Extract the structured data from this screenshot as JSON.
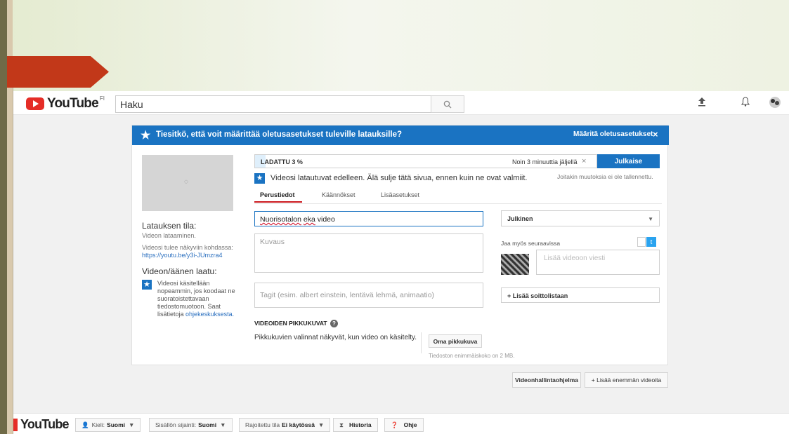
{
  "youtube": {
    "logo_text": "YouTube",
    "logo_region": "FI",
    "search_value": "Haku",
    "icons": {
      "search": "search-icon",
      "upload": "upload-icon",
      "bell": "bell-icon",
      "avatar": "avatar-icon"
    }
  },
  "banner": {
    "text": "Tiesitkö, että voit määrittää oletusasetukset tuleville latauksille?",
    "button": "Määritä oletusasetukset",
    "close": "×"
  },
  "upload": {
    "progress_label": "LADATTU 3 %",
    "progress_fraction": 0.03,
    "time_left": "Noin 3 minuuttia jäljellä",
    "publish": "Julkaise",
    "notice": "Videosi latautuvat edelleen. Älä sulje tätä sivua, ennen kuin ne ovat valmiit.",
    "unsaved": "Joitakin muutoksia ei ole tallennettu."
  },
  "tabs": [
    "Perustiedot",
    "Käännökset",
    "Lisäasetukset"
  ],
  "status": {
    "heading": "Latauksen tila:",
    "line1": "Videon lataaminen.",
    "line2": "Videosi tulee näkyviin kohdassa:",
    "link": "https://youtu.be/y3i-JUmzra4",
    "quality_heading": "Videon/äänen laatu:",
    "quality_text": "Videosi käsitellään nopeammin, jos koodaat ne suoratoistettavaan tiedostomuotoon. Saat lisätietoja",
    "quality_link": "ohjekeskuksesta."
  },
  "form": {
    "title_word1": "Nuorisotalon",
    "title_word2": "eka",
    "title_word3": "video",
    "description_placeholder": "Kuvaus",
    "tags_placeholder": "Tagit (esim. albert einstein, lentävä lehmä, animaatio)",
    "privacy": "Julkinen",
    "share_label": "Jaa myös seuraavissa",
    "message_placeholder": "Lisää videoon viesti",
    "playlist": "+ Lisää soittolistaan"
  },
  "thumbnails": {
    "heading": "VIDEOIDEN PIKKUKUVAT",
    "text": "Pikkukuvien valinnat näkyvät, kun video on käsitelty.",
    "custom_button": "Oma pikkukuva",
    "size_note": "Tiedoston enimmäiskoko on 2 MB."
  },
  "actions": {
    "manager": "Videonhallintaohjelma",
    "add_more": "+ Lisää enemmän videoita"
  },
  "footer": {
    "logo_text": "YouTube",
    "language_label": "Kieli:",
    "language_value": "Suomi",
    "location_label": "Sisällön sijainti:",
    "location_value": "Suomi",
    "restricted_label": "Rajoitettu tila",
    "restricted_value": "Ei käytössä",
    "history": "Historia",
    "help": "Ohje"
  }
}
